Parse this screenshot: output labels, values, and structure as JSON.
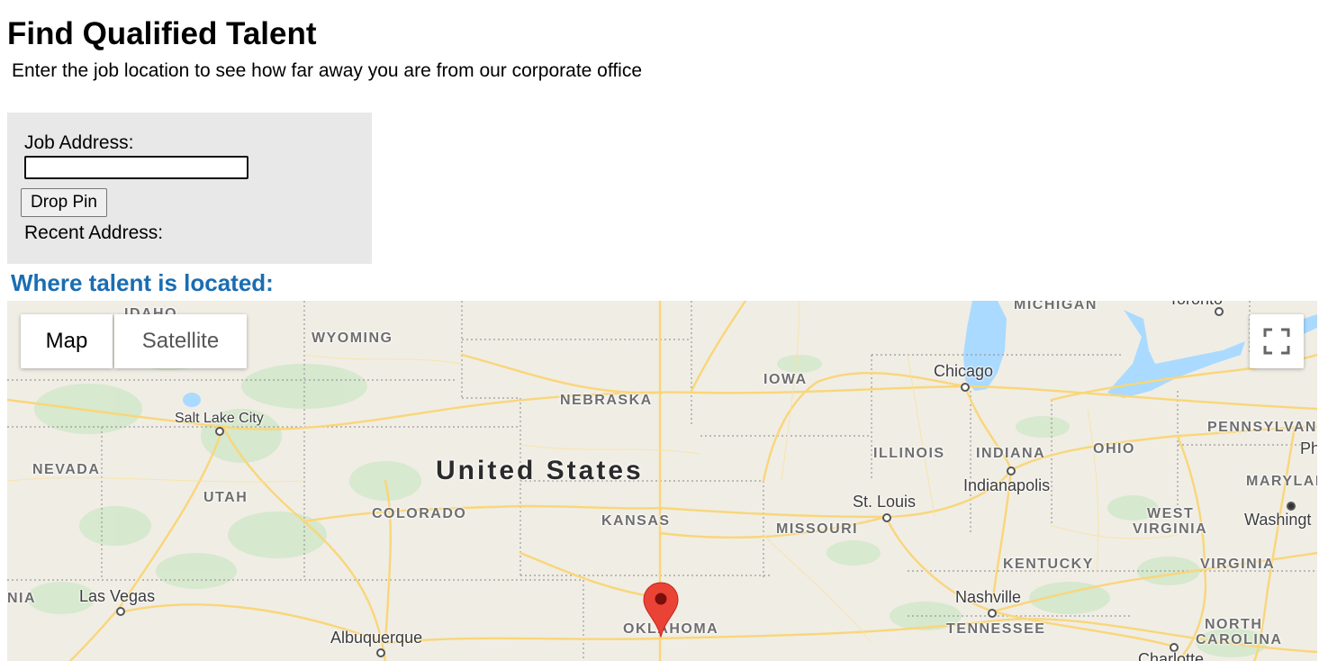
{
  "page": {
    "title": "Find Qualified Talent",
    "subtitle": "Enter the job location to see how far away you are from our corporate office"
  },
  "form": {
    "job_address_label": "Job Address:",
    "job_address_value": "",
    "drop_pin_label": "Drop Pin",
    "recent_address_label": "Recent Address:"
  },
  "section": {
    "heading": "Where talent is located:"
  },
  "map": {
    "type_controls": {
      "map_label": "Map",
      "satellite_label": "Satellite",
      "selected": "Map"
    },
    "fullscreen_icon": "fullscreen-icon",
    "country_label": "United States",
    "state_labels": {
      "michigan": "MICHIGAN",
      "wyoming": "WYOMING",
      "iowa": "IOWA",
      "nebraska": "NEBRASKA",
      "pennsylvania": "PENNSYLVAN",
      "nevada": "NEVADA",
      "illinois": "ILLINOIS",
      "indiana": "INDIANA",
      "ohio": "OHIO",
      "utah": "UTAH",
      "maryland": "MARYLAI",
      "colorado": "COLORADO",
      "kansas": "KANSAS",
      "missouri": "MISSOURI",
      "west_virginia_1": "WEST",
      "west_virginia_2": "VIRGINIA",
      "kentucky": "KENTUCKY",
      "virginia": "VIRGINIA",
      "california_partial": "NIA",
      "oklahoma": "OKLAHOMA",
      "tennessee": "TENNESSEE",
      "north_carolina_1": "NORTH",
      "north_carolina_2": "CAROLINA",
      "idaho_partial": "IDAHO"
    },
    "city_labels": {
      "toronto": "Toronto",
      "chicago": "Chicago",
      "salt_lake_city": "Salt Lake City",
      "philadelphia": "Ph",
      "indianapolis": "Indianapolis",
      "st_louis": "St. Louis",
      "washington": "Washingt",
      "las_vegas": "Las Vegas",
      "nashville": "Nashville",
      "albuquerque": "Albuquerque",
      "charlotte": "Charlotte"
    },
    "colors": {
      "land": "#f0ede5",
      "water": "#aadaff",
      "road": "#fbd876",
      "park": "#cfe8c8",
      "pin": "#ea4335"
    }
  }
}
